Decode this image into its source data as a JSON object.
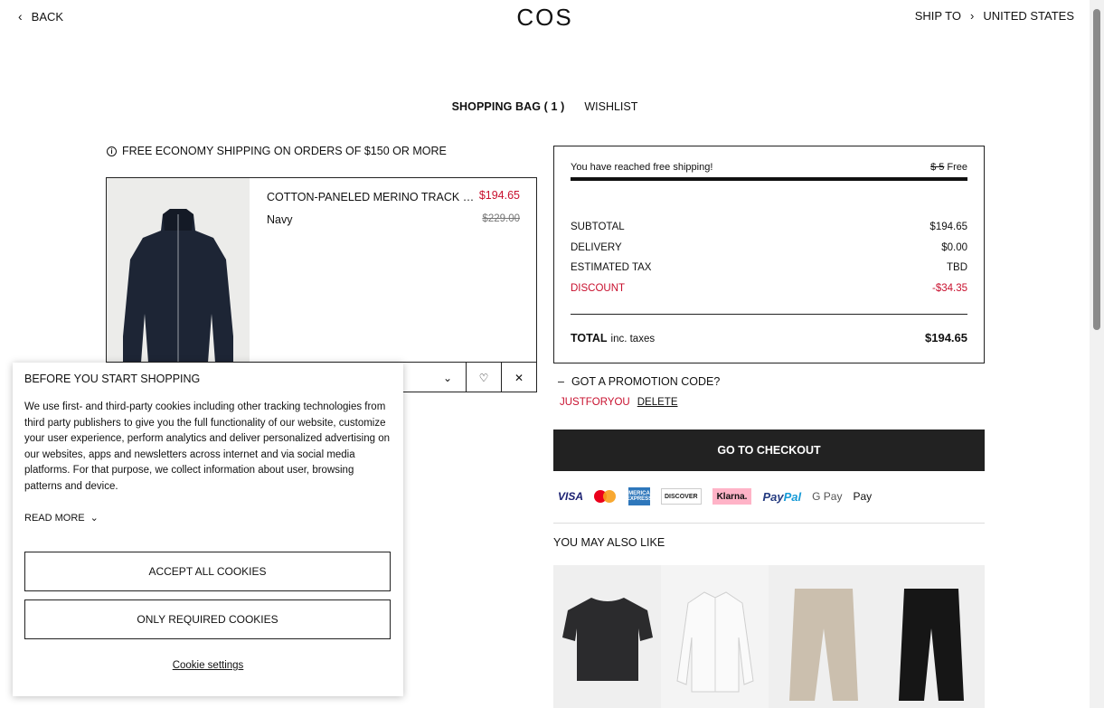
{
  "header": {
    "back_label": "BACK",
    "logo": "COS",
    "ship_to_label": "SHIP TO",
    "ship_to_country": "UNITED STATES"
  },
  "tabs": {
    "bag": "SHOPPING BAG ( 1 )",
    "wishlist": "WISHLIST"
  },
  "notice": "FREE ECONOMY SHIPPING ON ORDERS OF $150 OR MORE",
  "cart_item": {
    "name": "COTTON-PANELED MERINO TRACK JACKET",
    "price": "$194.65",
    "original_price": "$229.00",
    "color": "Navy"
  },
  "summary": {
    "free_shipping_msg": "You have reached free shipping!",
    "free_shipping_old": "$ 5",
    "free_shipping_new": "Free",
    "progress_fraction": 1.0,
    "subtotal_label": "SUBTOTAL",
    "subtotal_value": "$194.65",
    "delivery_label": "DELIVERY",
    "delivery_value": "$0.00",
    "tax_label": "ESTIMATED TAX",
    "tax_value": "TBD",
    "discount_label": "DISCOUNT",
    "discount_value": "-$34.35",
    "total_label": "TOTAL",
    "total_sub": "inc. taxes",
    "total_value": "$194.65"
  },
  "promo": {
    "toggle_label": "GOT A PROMOTION CODE?",
    "code": "JUSTFORYOU",
    "delete_label": "DELETE"
  },
  "checkout_label": "GO TO CHECKOUT",
  "payments": {
    "visa": "VISA",
    "amex": "AMERICAN EXPRESS",
    "discover": "DISCOVER",
    "klarna": "Klarna.",
    "paypal_a": "Pay",
    "paypal_b": "Pal",
    "gpay": "G Pay",
    "applepay": " Pay"
  },
  "recommendations_title": "YOU MAY ALSO LIKE",
  "cookie": {
    "title": "BEFORE YOU START SHOPPING",
    "text": "We use first- and third-party cookies including other tracking technologies from third party publishers to give you the full functionality of our website, customize your user experience, perform analytics and deliver personalized advertising on our websites, apps and newsletters across internet and via social media platforms. For that purpose, we collect information about user, browsing patterns and device.",
    "read_more": "READ MORE",
    "accept_all": "ACCEPT ALL COOKIES",
    "only_required": "ONLY REQUIRED COOKIES",
    "settings": "Cookie settings"
  },
  "colors": {
    "accent_red": "#c8102e",
    "checkout_bg": "#222222"
  }
}
